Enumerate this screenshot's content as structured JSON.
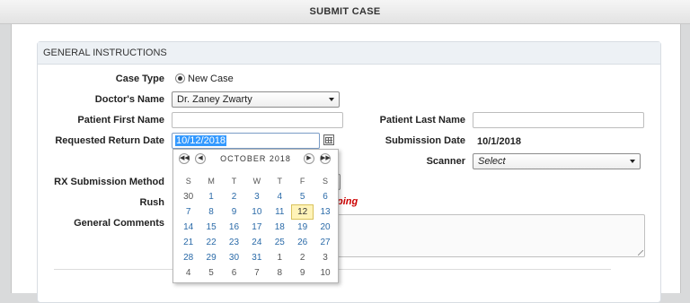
{
  "window": {
    "title": "SUBMIT CASE"
  },
  "section": {
    "title": "GENERAL INSTRUCTIONS"
  },
  "form": {
    "case_type_label": "Case Type",
    "case_type_option": "New Case",
    "doctors_name_label": "Doctor's Name",
    "doctors_name_value": "Dr. Zaney Zwarty",
    "patient_first_name_label": "Patient First Name",
    "patient_first_name_value": "",
    "patient_last_name_label": "Patient Last Name",
    "patient_last_name_value": "",
    "requested_return_date_label": "Requested Return Date",
    "requested_return_date_value": "10/12/2018",
    "submission_date_label": "Submission Date",
    "submission_date_value": "10/1/2018",
    "scanner_label": "Scanner",
    "scanner_value": "Select",
    "rx_submission_method_label": "RX Submission Method",
    "rush_label": "Rush",
    "rush_warning_partial": "ping",
    "general_comments_label": "General Comments"
  },
  "datepicker": {
    "month_label": "OCTOBER 2018",
    "days_of_week": [
      "S",
      "M",
      "T",
      "W",
      "T",
      "F",
      "S"
    ],
    "weeks": [
      [
        "30",
        "1",
        "2",
        "3",
        "4",
        "5",
        "6"
      ],
      [
        "7",
        "8",
        "9",
        "10",
        "11",
        "12",
        "13"
      ],
      [
        "14",
        "15",
        "16",
        "17",
        "18",
        "19",
        "20"
      ],
      [
        "21",
        "22",
        "23",
        "24",
        "25",
        "26",
        "27"
      ],
      [
        "28",
        "29",
        "30",
        "31",
        "1",
        "2",
        "3"
      ],
      [
        "4",
        "5",
        "6",
        "7",
        "8",
        "9",
        "10"
      ]
    ],
    "selected_day": "12",
    "nav": {
      "prev_year": "◀◀",
      "prev_month": "◀",
      "next_month": "▶",
      "next_year": "▶▶"
    }
  },
  "colors": {
    "warning": "#cc0000",
    "today_highlight": "#fff3b8",
    "link_day": "#2a6aa8"
  }
}
